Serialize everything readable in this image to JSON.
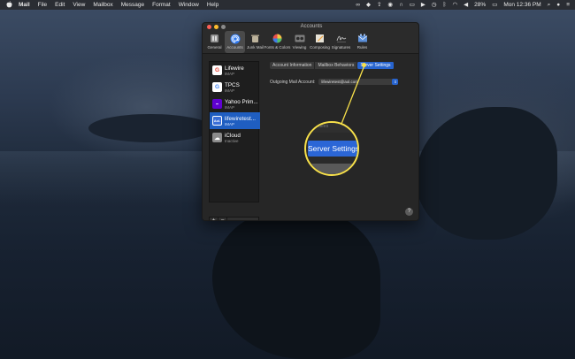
{
  "menubar": {
    "app_name": "Mail",
    "items": [
      "File",
      "Edit",
      "View",
      "Mailbox",
      "Message",
      "Format",
      "Window",
      "Help"
    ],
    "battery": "28%",
    "clock": "Mon 12:36 PM"
  },
  "window": {
    "title": "Accounts",
    "toolbar": [
      {
        "label": "General",
        "icon": "switch-icon"
      },
      {
        "label": "Accounts",
        "icon": "at-icon"
      },
      {
        "label": "Junk Mail",
        "icon": "trash-icon"
      },
      {
        "label": "Fonts & Colors",
        "icon": "color-wheel-icon"
      },
      {
        "label": "Viewing",
        "icon": "glasses-icon"
      },
      {
        "label": "Composing",
        "icon": "pencil-icon"
      },
      {
        "label": "Signatures",
        "icon": "signature-icon"
      },
      {
        "label": "Rules",
        "icon": "envelope-icon"
      }
    ],
    "selected_tab": "Accounts"
  },
  "accounts": [
    {
      "name": "Lifewire",
      "type": "IMAP",
      "icon": "G",
      "icon_bg": "#ffffff",
      "icon_color": "#ea4335"
    },
    {
      "name": "TPCS",
      "type": "IMAP",
      "icon": "G",
      "icon_bg": "#ffffff",
      "icon_color": "#4285f4"
    },
    {
      "name": "Yahoo Prim...",
      "type": "IMAP",
      "icon": "Y",
      "icon_bg": "#5f01d1",
      "icon_color": "#ffffff"
    },
    {
      "name": "lifewiretest...",
      "type": "IMAP",
      "icon": "Aol.",
      "icon_bg": "#3a6fd8",
      "icon_color": "#ffffff"
    },
    {
      "name": "iCloud",
      "type": "Inactive",
      "icon": "☁",
      "icon_bg": "#8a8a8a",
      "icon_color": "#ffffff"
    }
  ],
  "list_buttons": {
    "add": "+",
    "remove": "−"
  },
  "tabs": [
    "Account Information",
    "Mailbox Behaviors",
    "Server Settings"
  ],
  "active_tab": "Server Settings",
  "outgoing": {
    "label": "Outgoing Mail Account:",
    "value": "lifewiretest@aol.com"
  },
  "callout": {
    "tab_label": "Server Settings",
    "faded_text": "ailes"
  },
  "help_label": "?",
  "colors": {
    "accent": "#2764cf",
    "highlight": "#f7e04a"
  }
}
